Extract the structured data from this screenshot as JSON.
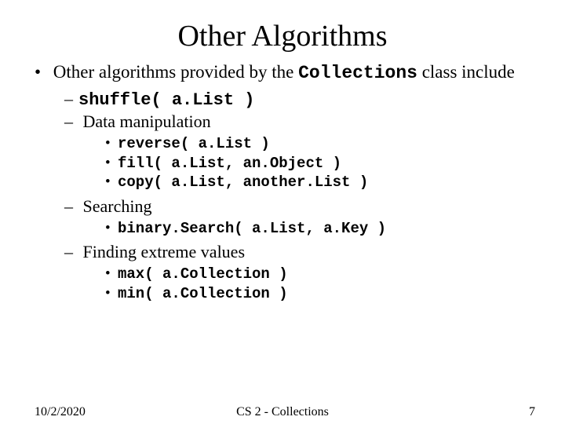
{
  "title": "Other Algorithms",
  "intro": {
    "before": "Other algorithms provided by the ",
    "code": "Collections",
    "after": " class include"
  },
  "items": {
    "shuffle": "shuffle( a.List )",
    "datamanip": {
      "label": "Data manipulation",
      "reverse": "reverse( a.List )",
      "fill": "fill( a.List, an.Object )",
      "copy": "copy( a.List, another.List )"
    },
    "searching": {
      "label": "Searching",
      "binary": "binary.Search( a.List, a.Key )"
    },
    "extreme": {
      "label": "Finding extreme values",
      "max": "max( a.Collection )",
      "min": "min( a.Collection )"
    }
  },
  "footer": {
    "date": "10/2/2020",
    "center": "CS 2 - Collections",
    "page": "7"
  }
}
